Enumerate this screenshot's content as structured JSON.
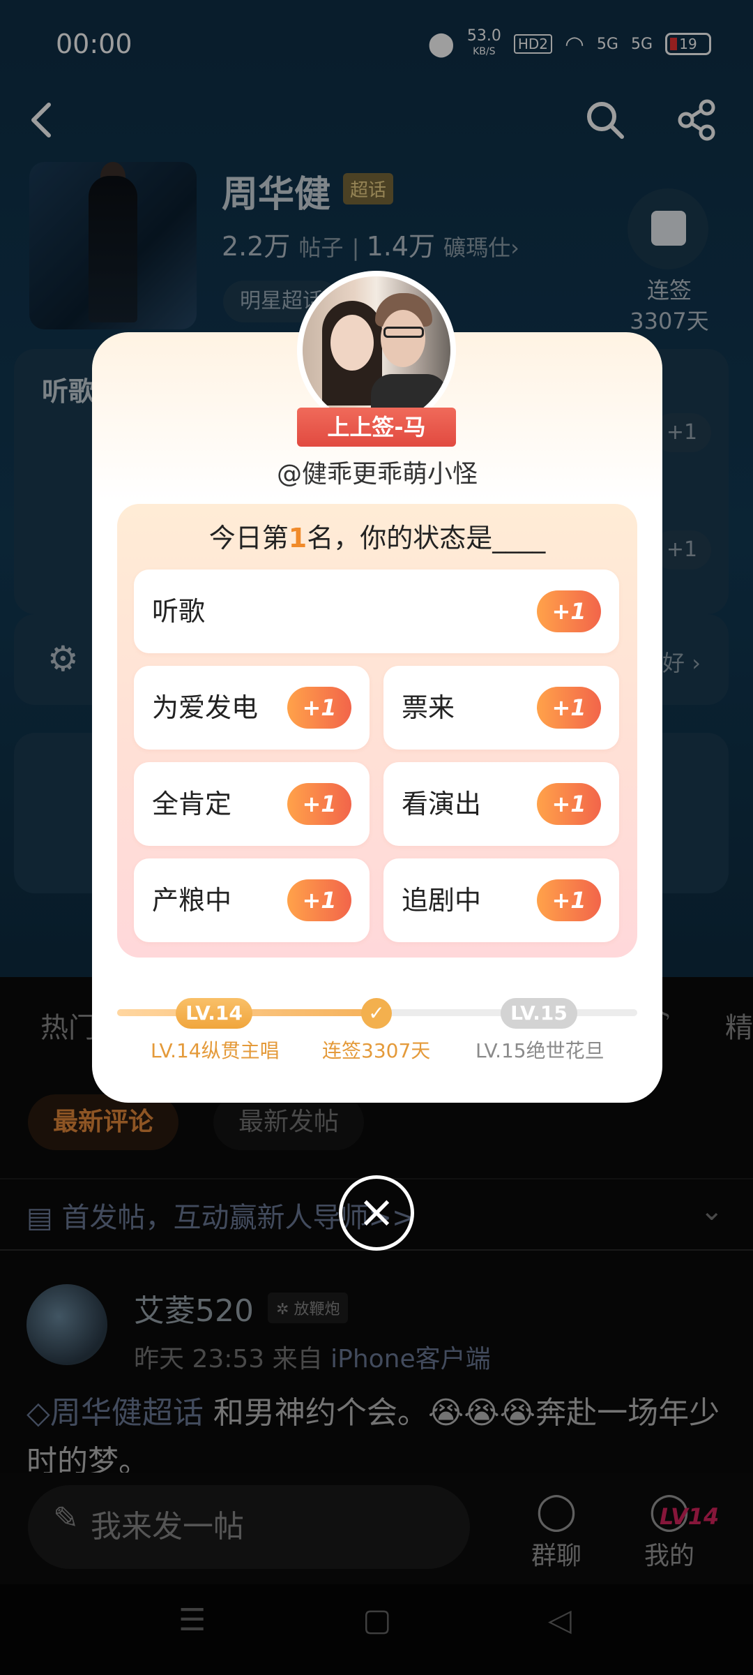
{
  "status_bar": {
    "time": "00:00",
    "net_speed": "53.0",
    "net_unit": "KB/S",
    "hd": "HD2",
    "sig1": "5G",
    "sig2": "5G",
    "battery": "19"
  },
  "header": {
    "title": "周华健",
    "badge": "超话",
    "posts_count": "2.2万",
    "posts_label": "帖子",
    "fans_count": "1.4万",
    "fans_label": "礦瑪仕",
    "category": "明星超话",
    "sign_label": "连签",
    "sign_days": "3307天"
  },
  "background": {
    "card_label": "听歌",
    "plus": "+1",
    "prefs": "好",
    "tab_hot": "热门",
    "tab_jing": "精",
    "chip_comments": "最新评论",
    "chip_posts": "最新发帖",
    "notice": "首发帖，互动赢新人导师>>"
  },
  "post": {
    "author": "艾菱520",
    "badge": "放鞭炮",
    "time": "昨天 23:53",
    "from_label": "来自",
    "source": "iPhone客户端",
    "topic": "周华健超话",
    "text": "和男神约个会。😭😭😭奔赴一场年少时的梦。"
  },
  "bottom_bar": {
    "compose_placeholder": "我来发一帖",
    "group_chat": "群聊",
    "mine": "我的",
    "mine_level": "LV14"
  },
  "modal": {
    "ribbon": "上上签-马",
    "username": "@健乖更乖萌小怪",
    "rank_prefix": "今日第",
    "rank_num": "1",
    "rank_suffix": "名，你的状态是____",
    "plus": "+1",
    "options": [
      "听歌",
      "为爱发电",
      "票来",
      "全肯定",
      "看演出",
      "产粮中",
      "追剧中"
    ],
    "level": {
      "current_pill": "LV.14",
      "next_pill": "LV.15",
      "current_label": "LV.14纵贯主唱",
      "streak_label": "连签3307天",
      "next_label": "LV.15绝世花旦",
      "progress": 0.5
    }
  }
}
